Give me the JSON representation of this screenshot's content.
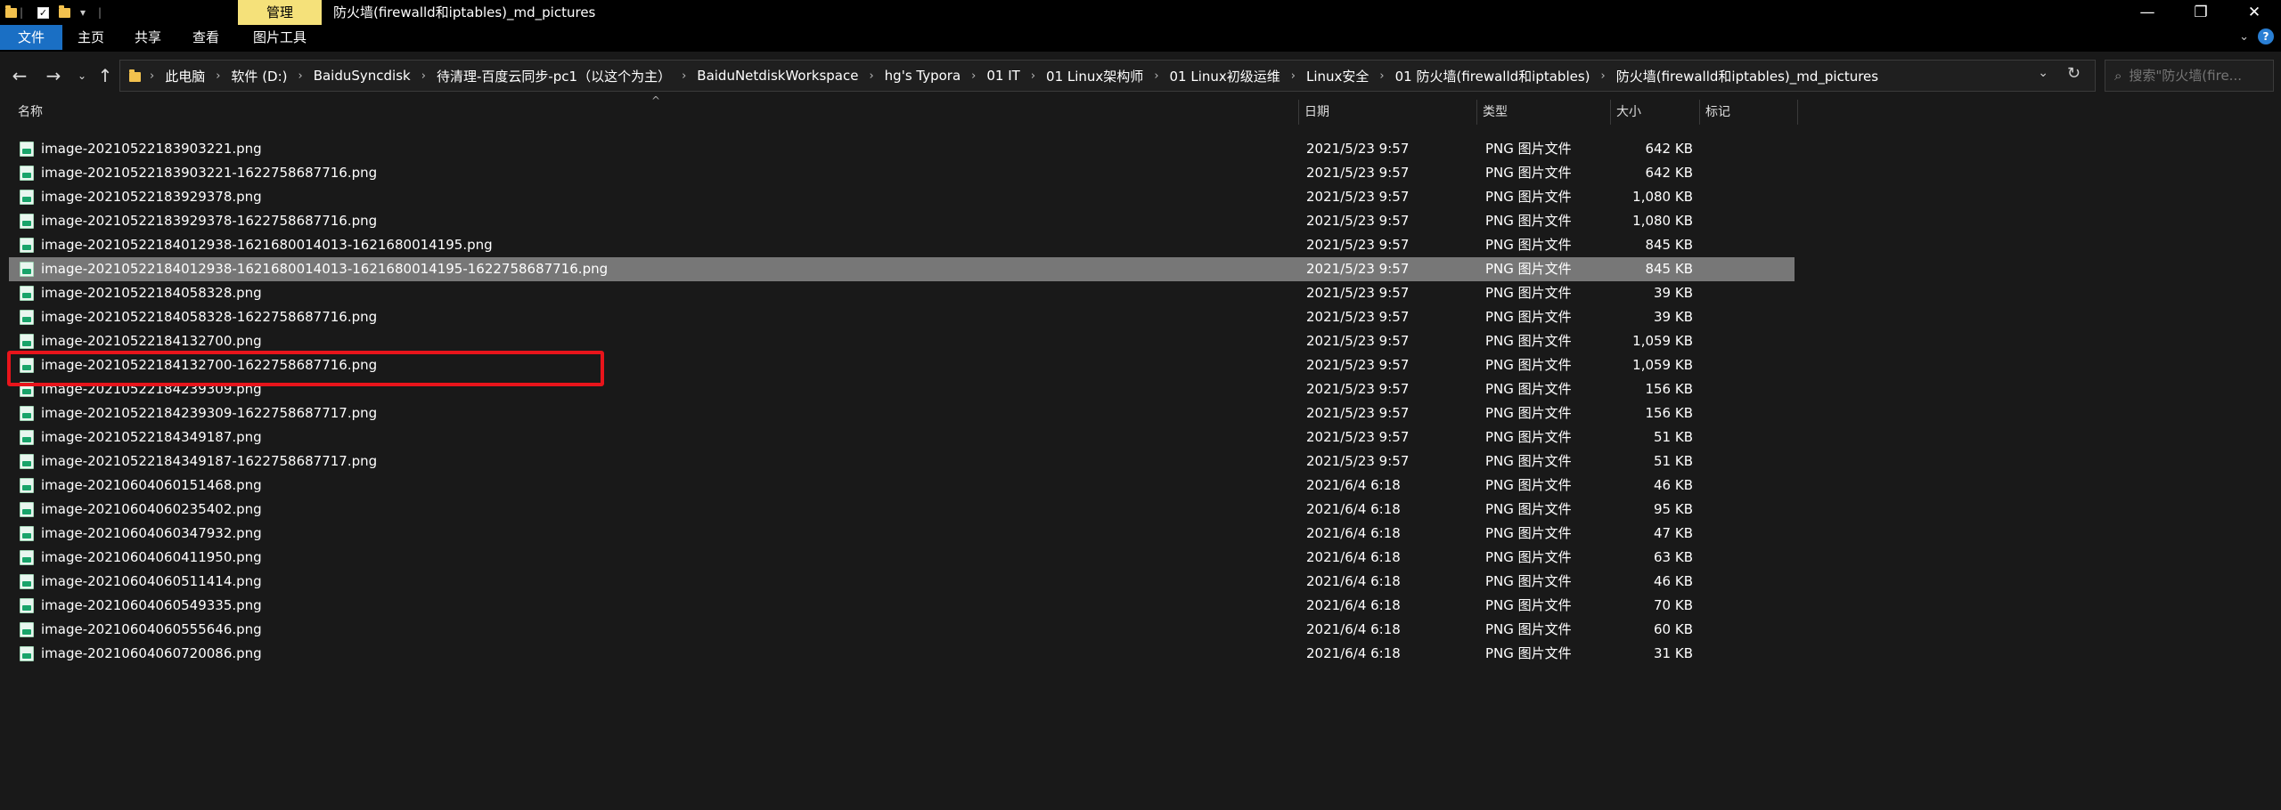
{
  "titlebar": {
    "manage_tab": "管理",
    "title": "防火墙(firewalld和iptables)_md_pictures",
    "controls": {
      "minimize": "—",
      "maximize": "❐",
      "close": "✕"
    }
  },
  "ribbon": {
    "tabs": [
      {
        "label": "文件",
        "active": true
      },
      {
        "label": "主页",
        "active": false
      },
      {
        "label": "共享",
        "active": false
      },
      {
        "label": "查看",
        "active": false
      },
      {
        "label": "图片工具",
        "active": false
      }
    ]
  },
  "address": {
    "breadcrumbs": [
      "此电脑",
      "软件 (D:)",
      "BaiduSyncdisk",
      "待清理-百度云同步-pc1（以这个为主）",
      "BaiduNetdiskWorkspace",
      "hg's Typora",
      "01 IT",
      "01 Linux架构师",
      "01 Linux初级运维",
      "Linux安全",
      "01 防火墙(firewalld和iptables)",
      "防火墙(firewalld和iptables)_md_pictures"
    ]
  },
  "search": {
    "placeholder": "搜索\"防火墙(fire..."
  },
  "columns": {
    "name": "名称",
    "date": "日期",
    "type": "类型",
    "size": "大小",
    "tags": "标记"
  },
  "files": [
    {
      "name": "image-20210522183903221.png",
      "date": "2021/5/23 9:57",
      "type": "PNG 图片文件",
      "size": "642 KB"
    },
    {
      "name": "image-20210522183903221-1622758687716.png",
      "date": "2021/5/23 9:57",
      "type": "PNG 图片文件",
      "size": "642 KB"
    },
    {
      "name": "image-20210522183929378.png",
      "date": "2021/5/23 9:57",
      "type": "PNG 图片文件",
      "size": "1,080 KB"
    },
    {
      "name": "image-20210522183929378-1622758687716.png",
      "date": "2021/5/23 9:57",
      "type": "PNG 图片文件",
      "size": "1,080 KB"
    },
    {
      "name": "image-20210522184012938-1621680014013-1621680014195.png",
      "date": "2021/5/23 9:57",
      "type": "PNG 图片文件",
      "size": "845 KB"
    },
    {
      "name": "image-20210522184012938-1621680014013-1621680014195-1622758687716.png",
      "date": "2021/5/23 9:57",
      "type": "PNG 图片文件",
      "size": "845 KB",
      "selected": true
    },
    {
      "name": "image-20210522184058328.png",
      "date": "2021/5/23 9:57",
      "type": "PNG 图片文件",
      "size": "39 KB"
    },
    {
      "name": "image-20210522184058328-1622758687716.png",
      "date": "2021/5/23 9:57",
      "type": "PNG 图片文件",
      "size": "39 KB"
    },
    {
      "name": "image-20210522184132700.png",
      "date": "2021/5/23 9:57",
      "type": "PNG 图片文件",
      "size": "1,059 KB"
    },
    {
      "name": "image-20210522184132700-1622758687716.png",
      "date": "2021/5/23 9:57",
      "type": "PNG 图片文件",
      "size": "1,059 KB"
    },
    {
      "name": "image-20210522184239309.png",
      "date": "2021/5/23 9:57",
      "type": "PNG 图片文件",
      "size": "156 KB"
    },
    {
      "name": "image-20210522184239309-1622758687717.png",
      "date": "2021/5/23 9:57",
      "type": "PNG 图片文件",
      "size": "156 KB"
    },
    {
      "name": "image-20210522184349187.png",
      "date": "2021/5/23 9:57",
      "type": "PNG 图片文件",
      "size": "51 KB"
    },
    {
      "name": "image-20210522184349187-1622758687717.png",
      "date": "2021/5/23 9:57",
      "type": "PNG 图片文件",
      "size": "51 KB"
    },
    {
      "name": "image-20210604060151468.png",
      "date": "2021/6/4 6:18",
      "type": "PNG 图片文件",
      "size": "46 KB"
    },
    {
      "name": "image-20210604060235402.png",
      "date": "2021/6/4 6:18",
      "type": "PNG 图片文件",
      "size": "95 KB"
    },
    {
      "name": "image-20210604060347932.png",
      "date": "2021/6/4 6:18",
      "type": "PNG 图片文件",
      "size": "47 KB"
    },
    {
      "name": "image-20210604060411950.png",
      "date": "2021/6/4 6:18",
      "type": "PNG 图片文件",
      "size": "63 KB"
    },
    {
      "name": "image-20210604060511414.png",
      "date": "2021/6/4 6:18",
      "type": "PNG 图片文件",
      "size": "46 KB"
    },
    {
      "name": "image-20210604060549335.png",
      "date": "2021/6/4 6:18",
      "type": "PNG 图片文件",
      "size": "70 KB"
    },
    {
      "name": "image-20210604060555646.png",
      "date": "2021/6/4 6:18",
      "type": "PNG 图片文件",
      "size": "60 KB"
    },
    {
      "name": "image-20210604060720086.png",
      "date": "2021/6/4 6:18",
      "type": "PNG 图片文件",
      "size": "31 KB"
    }
  ],
  "colors": {
    "accent": "#1a6fc4",
    "manage_tab": "#f5e17a",
    "selection": "#777777",
    "highlight": "#e8141b"
  },
  "icons": {
    "qa_folder": "folder-icon",
    "qa_check": "properties-check-icon",
    "nav_back": "arrow-left-icon",
    "nav_forward": "arrow-right-icon",
    "nav_recent": "chevron-down-icon",
    "nav_up": "arrow-up-icon",
    "refresh": "refresh-icon",
    "search": "search-icon",
    "file": "png-file-icon"
  }
}
